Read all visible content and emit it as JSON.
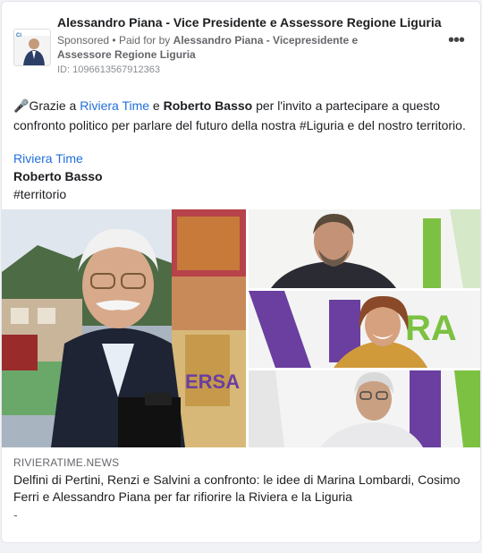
{
  "post": {
    "author": "Alessandro Piana - Vice Presidente e Assessore Regione Liguria",
    "sponsored": "Sponsored",
    "paid_prefix": "Paid for by",
    "payer": "Alessandro Piana - Vicepresidente e Assessore Regione Liguria",
    "ad_id": "ID: 1096613567912363",
    "more_icon": "ellipsis-icon"
  },
  "text": {
    "emoji": "🎤",
    "p1": "Grazie a ",
    "riviera_time": "Riviera Time",
    "p2": " e ",
    "roberto_basso": "Roberto Basso",
    "p3": " per l'invito a partecipare a questo confronto politico per parlare del futuro della nostra #Liguria e del nostro territorio.",
    "tag_link": "Riviera Time",
    "tag_name": "Roberto Basso",
    "hashtag": "#territorio"
  },
  "link_preview": {
    "domain": "RIVIERATIME.NEWS",
    "title": "Delfini di Pertini, Renzi e Salvini a confronto: le idee di Marina Lombardi, Cosimo Ferri e Alessandro Piana per far rifiorire la Riviera e la Liguria",
    "description": "-"
  },
  "colors": {
    "link": "#216fdb",
    "accent_purple": "#6a3fa0",
    "accent_green": "#7dc142"
  }
}
